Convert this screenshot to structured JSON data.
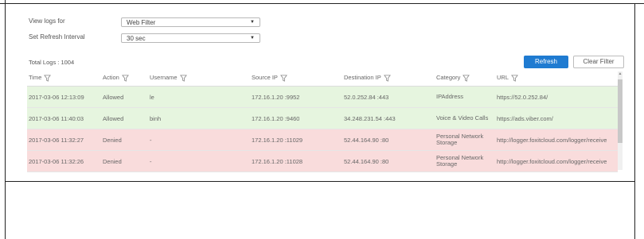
{
  "filters": {
    "view_logs_label": "View logs for",
    "view_logs_value": "Web Filter",
    "refresh_interval_label": "Set Refresh Interval",
    "refresh_interval_value": "30 sec"
  },
  "summary": {
    "total_logs": "Total Logs : 1004"
  },
  "buttons": {
    "refresh": "Refresh",
    "clear_filter": "Clear Filter"
  },
  "table": {
    "columns": [
      "Time",
      "Action",
      "Username",
      "Source IP",
      "Destination IP",
      "Category",
      "URL"
    ],
    "rows": [
      {
        "status": "allowed",
        "time": "2017-03-06 12:13:09",
        "action": "Allowed",
        "username": "le",
        "source_ip": "172.16.1.20 :9952",
        "destination_ip": "52.0.252.84 :443",
        "category": "IPAddress",
        "url": "https://52.0.252.84/"
      },
      {
        "status": "allowed",
        "time": "2017-03-06 11:40:03",
        "action": "Allowed",
        "username": "binh",
        "source_ip": "172.16.1.20 :9460",
        "destination_ip": "34.248.231.54 :443",
        "category": "Voice & Video Calls",
        "url": "https://ads.viber.com/"
      },
      {
        "status": "denied",
        "time": "2017-03-06 11:32:27",
        "action": "Denied",
        "username": "-",
        "source_ip": "172.16.1.20 :11029",
        "destination_ip": "52.44.164.90 :80",
        "category": "Personal Network Storage",
        "url": "http://logger.foxitcloud.com/logger/receive"
      },
      {
        "status": "denied",
        "time": "2017-03-06 11:32:26",
        "action": "Denied",
        "username": "-",
        "source_ip": "172.16.1.20 :11028",
        "destination_ip": "52.44.164.90 :80",
        "category": "Personal Network Storage",
        "url": "http://logger.foxitcloud.com/logger/receive"
      }
    ]
  },
  "colors": {
    "allowed_row": "#e6f5df",
    "denied_row": "#f9dcdc",
    "primary_button": "#1f7bd1"
  },
  "icons": {
    "column_filter": "funnel-icon",
    "dropdown": "caret-down-icon"
  }
}
